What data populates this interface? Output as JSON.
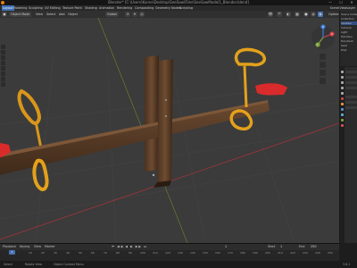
{
  "window": {
    "title": "Blender* [C:\\Users\\Karan\\Desktop\\SeeSaw\\Files\\SeeSawModel1_Blender.blend]",
    "minimize": "—",
    "maximize": "☐",
    "close": "✕"
  },
  "menubar": {
    "items": [
      "Layout",
      "Modeling",
      "Sculpting",
      "UV Editing",
      "Texture Paint",
      "Shading",
      "Animation",
      "Rendering",
      "Compositing",
      "Geometry Nodes",
      "Scripting"
    ],
    "scene": "Scene",
    "view_layer": "ViewLayer"
  },
  "toolbar": {
    "mode": "Object Mode",
    "view": "View",
    "select": "Select",
    "add": "Add",
    "object": "Object",
    "transform": "Global",
    "options": "Options"
  },
  "viewport": {
    "gizmo_axes": [
      "X",
      "Y",
      "Z"
    ]
  },
  "outliner": {
    "rows": [
      "Scene Collection",
      "Collection",
      "SeeSaw",
      "Camera",
      "Light",
      "Handle.L",
      "Handle.R",
      "Seat",
      "Post"
    ]
  },
  "timeline": {
    "playback": "Playback",
    "keying": "Keying",
    "view": "View",
    "marker": "Marker",
    "controls": "⏮ ◀◀ ◀ ▶ ▶▶ ⏭",
    "current_frame": "1",
    "start_label": "Start",
    "start_value": "1",
    "end_label": "End",
    "end_value": "250",
    "frame_ticks": [
      "10",
      "20",
      "30",
      "40",
      "50",
      "60",
      "70",
      "80",
      "90",
      "100",
      "110",
      "120",
      "130",
      "140",
      "150",
      "160",
      "170",
      "180",
      "190",
      "200",
      "210",
      "220",
      "230",
      "240",
      "250"
    ]
  },
  "statusbar": {
    "select": "Select",
    "rotate": "Rotate View",
    "context": "Object Context Menu",
    "version": "3.6.1"
  },
  "colors": {
    "accent": "#4772b3",
    "wood": "#5a3e28",
    "handle": "#e3a11b",
    "seat": "#d92b2b"
  }
}
